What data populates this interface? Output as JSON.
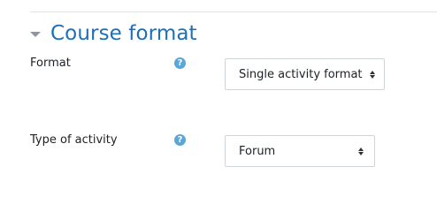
{
  "section": {
    "title": "Course format",
    "caret_icon": "caret-down-icon"
  },
  "fields": {
    "format": {
      "label": "Format",
      "help_icon": "question-circle-icon",
      "help_glyph": "?",
      "selected": "Single activity format"
    },
    "type_of_activity": {
      "label": "Type of activity",
      "help_icon": "question-circle-icon",
      "help_glyph": "?",
      "selected": "Forum"
    }
  },
  "colors": {
    "accent": "#1e6fb8",
    "help": "#5aa6d6",
    "border": "#cfd4da"
  }
}
